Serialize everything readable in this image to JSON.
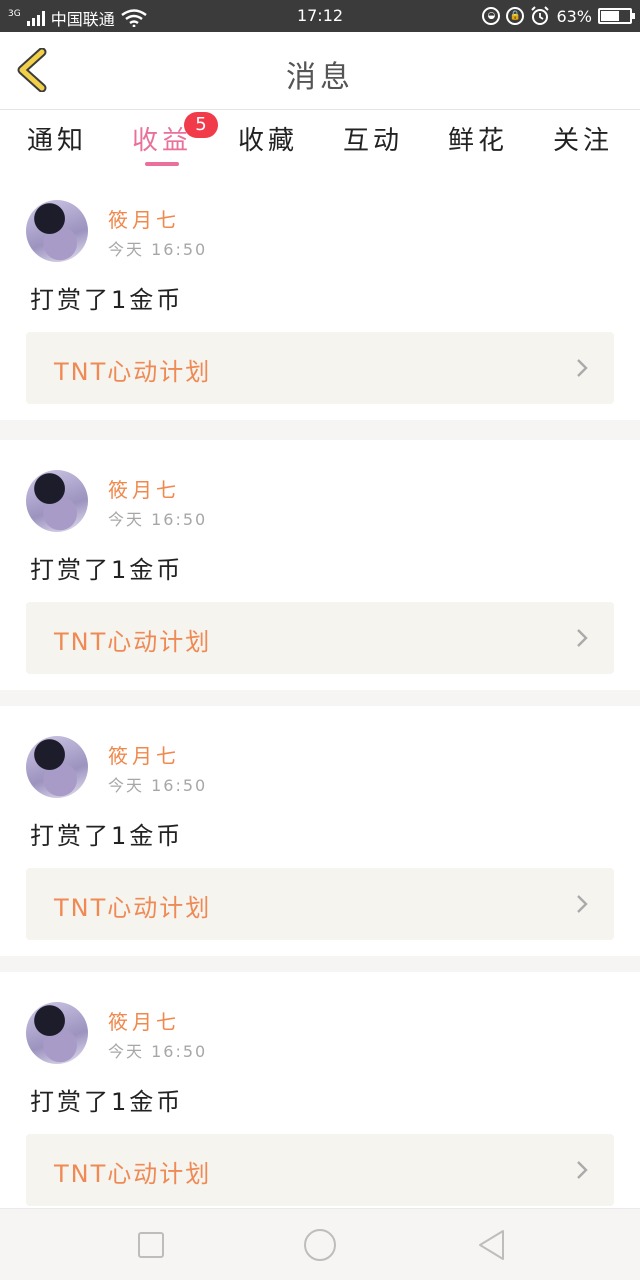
{
  "status_bar": {
    "network_type": "3G",
    "carrier": "中国联通",
    "time": "17:12",
    "battery_percent": "63%",
    "battery_level": 0.63,
    "icons": [
      "signal-icon",
      "wifi-icon",
      "eye-protect-icon",
      "rotation-lock-icon",
      "alarm-icon",
      "battery-icon"
    ]
  },
  "header": {
    "title": "消息",
    "back_icon": "chevron-left-icon"
  },
  "tabs": [
    {
      "label": "通知",
      "active": false
    },
    {
      "label": "收益",
      "active": true,
      "badge": "5"
    },
    {
      "label": "收藏",
      "active": false
    },
    {
      "label": "互动",
      "active": false
    },
    {
      "label": "鲜花",
      "active": false
    },
    {
      "label": "关注",
      "active": false
    }
  ],
  "messages": [
    {
      "author": "筱月七",
      "time": "今天 16:50",
      "text": "打赏了1金币",
      "link": "TNT心动计划"
    },
    {
      "author": "筱月七",
      "time": "今天 16:50",
      "text": "打赏了1金币",
      "link": "TNT心动计划"
    },
    {
      "author": "筱月七",
      "time": "今天 16:50",
      "text": "打赏了1金币",
      "link": "TNT心动计划"
    },
    {
      "author": "筱月七",
      "time": "今天 16:50",
      "text": "打赏了1金币",
      "link": "TNT心动计划"
    }
  ],
  "nav_bar": {
    "icons": [
      "recent-apps-icon",
      "home-icon",
      "back-icon"
    ]
  },
  "colors": {
    "accent_pink": "#e9709a",
    "badge_red": "#f23b4a",
    "author_orange": "#f0884c",
    "back_arrow_yellow": "#f3d04a"
  }
}
